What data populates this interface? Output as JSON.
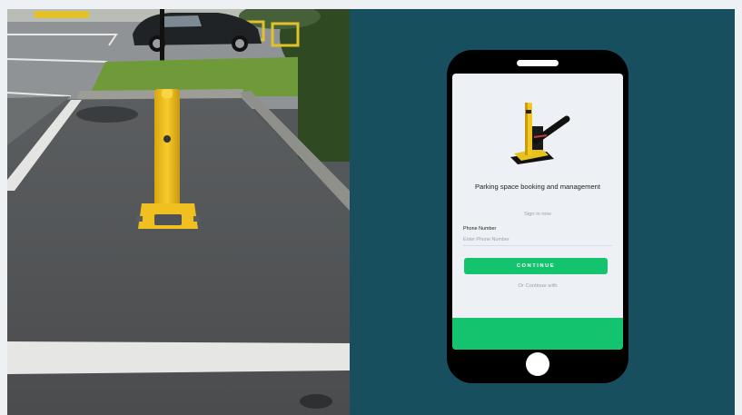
{
  "photo": {
    "subject": "Yellow parking bollard in an empty parking space"
  },
  "app": {
    "headline": "Parking space booking and management",
    "sign_in_label": "Sign in now",
    "phone_field_label": "Phone Number",
    "phone_field_placeholder": "Enter Phone Number",
    "phone_field_value": "",
    "continue_label": "CONTINUE",
    "alt_login_label": "Or Continue with"
  },
  "colors": {
    "device_panel_background": "#174f5f",
    "accent_green": "#14c36e",
    "bollard_yellow": "#f4c21a"
  }
}
